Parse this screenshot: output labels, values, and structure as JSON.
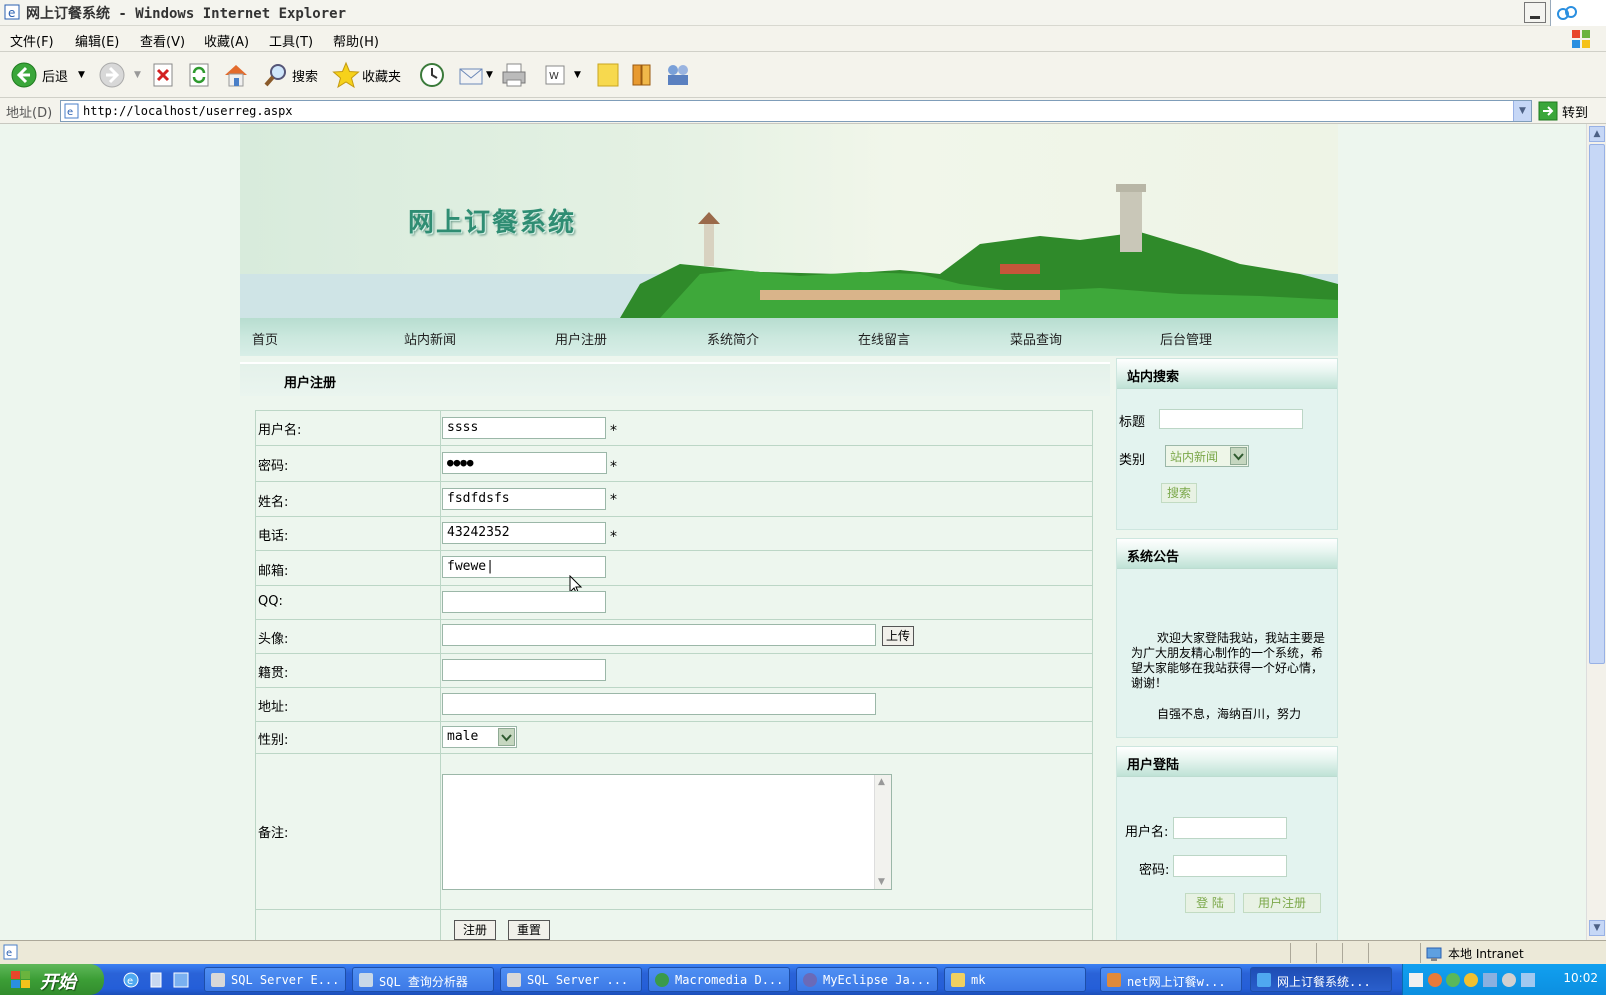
{
  "window": {
    "title": "网上订餐系统 - Windows Internet Explorer"
  },
  "menu": [
    "文件(F)",
    "编辑(E)",
    "查看(V)",
    "收藏(A)",
    "工具(T)",
    "帮助(H)"
  ],
  "toolbar": {
    "back_label": "后退",
    "search_label": "搜索",
    "favorites_label": "收藏夹"
  },
  "address": {
    "label": "地址(D)",
    "url": "http://localhost/userreg.aspx",
    "go_label": "转到"
  },
  "site": {
    "title": "网上订餐系统",
    "nav": [
      "首页",
      "站内新闻",
      "用户注册",
      "系统简介",
      "在线留言",
      "菜品查询",
      "后台管理"
    ]
  },
  "form": {
    "title": "用户注册",
    "rows": [
      {
        "label": "用户名:",
        "value": "ssss",
        "required": "*"
      },
      {
        "label": "密码:",
        "value": "●●●●",
        "required": "*"
      },
      {
        "label": "姓名:",
        "value": "fsdfdsfs",
        "required": "*"
      },
      {
        "label": "电话:",
        "value": "43242352",
        "required": "*"
      },
      {
        "label": "邮箱:",
        "value": "fwewe|"
      },
      {
        "label": "QQ:",
        "value": ""
      },
      {
        "label": "头像:",
        "value": "",
        "button": "上传"
      },
      {
        "label": "籍贯:",
        "value": ""
      },
      {
        "label": "地址:",
        "value": ""
      },
      {
        "label": "性别:",
        "value": "male"
      },
      {
        "label": "备注:",
        "value": ""
      }
    ],
    "submit_label": "注册",
    "reset_label": "重置"
  },
  "sidebar": {
    "search": {
      "title": "站内搜索",
      "title_label": "标题",
      "category_label": "类别",
      "category_value": "站内新闻",
      "button": "搜索"
    },
    "notice": {
      "title": "系统公告",
      "paragraphs": [
        "欢迎大家登陆我站，我站主要是为广大朋友精心制作的一个系统，希望大家能够在我站获得一个好心情，谢谢！",
        "自强不息，海纳百川，努力"
      ]
    },
    "login": {
      "title": "用户登陆",
      "username_label": "用户名:",
      "password_label": "密码:",
      "login_button": "登 陆",
      "register_button": "用户注册"
    }
  },
  "status": {
    "zone": "本地 Intranet"
  },
  "taskbar": {
    "start": "开始",
    "tasks": [
      "SQL Server E...",
      "SQL 查询分析器",
      "SQL Server ...",
      "Macromedia D...",
      "MyEclipse Ja...",
      "mk",
      "net网上订餐w...",
      "网上订餐系统..."
    ],
    "clock": "10:02"
  },
  "colors": {
    "page_bg": "#edf6ee",
    "title_green": "#2f8d73",
    "nav_bg": "#cbe8de",
    "taskbar_blue": "#245ed8"
  }
}
